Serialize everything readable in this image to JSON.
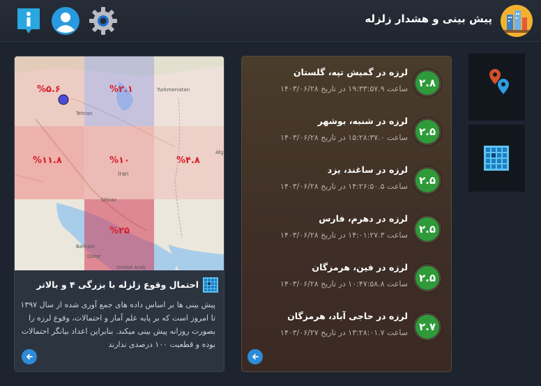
{
  "header": {
    "title": "پیش بینی و هشدار زلزله"
  },
  "colors": {
    "accent_blue": "#2d8bd8",
    "magnitude_green": "#2f9a3a",
    "risk_red": "#d7202a"
  },
  "quakes": [
    {
      "title": "لرزه در گمیش تپه، گلستان",
      "time": "ساعت ۱۹:۳۳:۵۷.۹ در تاریخ ۱۴۰۳/۰۶/۲۸",
      "magnitude": "۲.۸"
    },
    {
      "title": "لرزه در شنبه، بوشهر",
      "time": "ساعت ۱۵:۲۸:۳۷.۰ در تاریخ ۱۴۰۳/۰۶/۲۸",
      "magnitude": "۲.۵"
    },
    {
      "title": "لرزه در ساغند، یزد",
      "time": "ساعت ۱۴:۲۶:۵۰.۵ در تاریخ ۱۴۰۳/۰۶/۲۸",
      "magnitude": "۲.۵"
    },
    {
      "title": "لرزه در دهرم، فارس",
      "time": "ساعت ۱۴:۰۱:۲۷.۳ در تاریخ ۱۴۰۳/۰۶/۲۸",
      "magnitude": "۲.۵"
    },
    {
      "title": "لرزه در فین، هرمزگان",
      "time": "ساعت ۱۰:۴۷:۵۸.۸ در تاریخ ۱۴۰۳/۰۶/۲۸",
      "magnitude": "۲.۵"
    },
    {
      "title": "لرزه در حاجی آباد، هرمزگان",
      "time": "ساعت ۱۳:۲۸:۰۱.۷ در تاریخ ۱۴۰۳/۰۶/۲۷",
      "magnitude": "۲.۷"
    }
  ],
  "forecast": {
    "title": "احتمال وقوع زلزله با بزرگی ۴ و بالاتر",
    "description": "پیش بینی ها بر اساس داده های جمع آوری شده از سال ۱۳۹۷ تا امروز است که بر پایه علم آمار و احتمالات، وقوع لرزه را بصورت روزانه پیش بینی میکند. بنابراین اعداد بیانگر احتمالات بوده و قطعیت ۱۰۰ درصدی ندارند",
    "cells": [
      {
        "label": "%۵.۶",
        "risk": 0.056
      },
      {
        "label": "%۲.۱",
        "risk": 0.021
      },
      {
        "label": "%۱۱.۸",
        "risk": 0.118
      },
      {
        "label": "%۱۰",
        "risk": 0.1
      },
      {
        "label": "%۴.۸",
        "risk": 0.048
      },
      {
        "label": "%۲۵",
        "risk": 0.25
      }
    ],
    "map_labels": {
      "turkmenistan": "Turkmenistan",
      "iran": "Iran",
      "afg": "Afg",
      "bahrain": "Bahrain",
      "qatar": "Qatar",
      "uae": "United Arab",
      "shiraz": "Shiraz",
      "tehran": "Tehran"
    }
  }
}
